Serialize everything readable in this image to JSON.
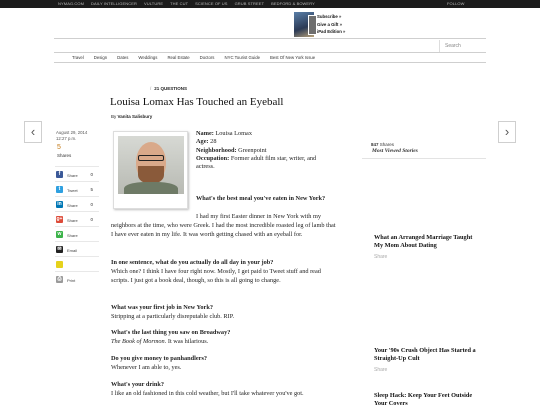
{
  "topbar": {
    "links": [
      "NYMAG.COM",
      "DAILY INTELLIGENCER",
      "VULTURE",
      "THE CUT",
      "SCIENCE OF US",
      "GRUB STREET",
      "BEDFORD & BOWERY"
    ],
    "follow": "FOLLOW"
  },
  "subscribe": {
    "items": [
      "Subscribe »",
      "Give a Gift »",
      "iPad Edition »"
    ]
  },
  "search": {
    "placeholder": "Search"
  },
  "nav": {
    "items": [
      "Travel",
      "Design",
      "Dates",
      "Weddings",
      "Real Estate",
      "Doctors",
      "NYC Tourist Guide",
      "Best Of New York Issue"
    ]
  },
  "article": {
    "kicker": "21 QUESTIONS",
    "title": "Louisa Lomax Has Touched an Eyeball",
    "byline_prefix": "By",
    "byline_author": "Vanita Salisbury",
    "date": "August 29, 2014",
    "time": "12:27 p.m.",
    "share_count": "5",
    "share_label": "Shares",
    "bio": {
      "name_label": "Name:",
      "name": "Louisa Lomax",
      "age_label": "Age:",
      "age": "28",
      "hood_label": "Neighborhood:",
      "hood": "Greenpoint",
      "occ_label": "Occupation:",
      "occ": "Former adult film star, writer, and actress."
    },
    "qa": [
      {
        "q": "What's the best meal you've eaten in New York?",
        "a": "I had my first Easter dinner in New York with my neighbors at the time, who were Greek. I had the most incredible roasted leg of lamb that I have ever eaten in my life. It was worth getting chased with an eyeball for."
      },
      {
        "q": "In one sentence, what do you actually do all day in your job?",
        "a": "Which one? I think I have four right now. Mostly, I get paid to Tweet stuff and read scripts. I just got a book deal, though, so this is all going to change."
      },
      {
        "q": "What was your first job in New York?",
        "a": "Stripping at a particularly disreputable club. RIP."
      },
      {
        "q": "What's the last thing you saw on Broadway?",
        "a_italic": "The Book of Mormon",
        "a": ". It was hilarious."
      },
      {
        "q": "Do you give money to panhandlers?",
        "a": "Whenever I am able to, yes."
      },
      {
        "q": "What's your drink?",
        "a": "I like an old fashioned in this cold weather, but I'll take whatever you've got."
      }
    ]
  },
  "share_buttons": [
    {
      "icon": "facebook-icon",
      "glyph": "f",
      "color": "#3b5998",
      "label": "Share",
      "count": "0"
    },
    {
      "icon": "twitter-icon",
      "glyph": "t",
      "color": "#2fa0e0",
      "label": "Tweet",
      "count": "5"
    },
    {
      "icon": "linkedin-icon",
      "glyph": "in",
      "color": "#0077b5",
      "label": "Share",
      "count": "0"
    },
    {
      "icon": "googleplus-icon",
      "glyph": "g+",
      "color": "#dd4b39",
      "label": "Share",
      "count": "0"
    },
    {
      "icon": "whatsapp-icon",
      "glyph": "w",
      "color": "#3cb34a",
      "label": "Share",
      "count": ""
    },
    {
      "icon": "email-icon",
      "glyph": "✉",
      "color": "#222222",
      "label": "Email",
      "count": ""
    },
    {
      "icon": "comment-icon",
      "glyph": "",
      "color": "#e6d21c",
      "label": "",
      "count": ""
    },
    {
      "icon": "print-icon",
      "glyph": "⎙",
      "color": "#9a9a9a",
      "label": "Print",
      "count": ""
    }
  ],
  "sidebar": {
    "count": "847",
    "count_label": "Shares",
    "title": "Most Viewed Stories",
    "items": [
      {
        "title": "What an Arranged Marriage Taught My Mom About Dating",
        "share": "Share"
      },
      {
        "title": "Your '90s Crush Object Has Started a Straight-Up Cult",
        "share": "Share"
      },
      {
        "title": "Sleep Hack: Keep Your Feet Outside Your Covers",
        "share": ""
      }
    ]
  }
}
